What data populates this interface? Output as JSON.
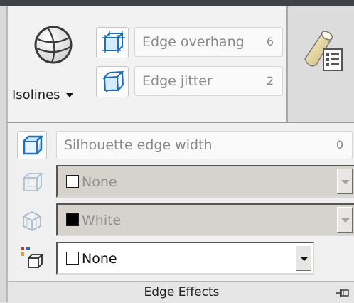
{
  "panel": {
    "title": "Edge Effects",
    "pin_icon": "pin-icon"
  },
  "isolines": {
    "label": "Isolines",
    "icon": "sphere-icon"
  },
  "edge_overhang": {
    "label": "Edge overhang",
    "value": "6",
    "icon": "overhang-cube-icon"
  },
  "edge_jitter": {
    "label": "Edge jitter",
    "value": "2",
    "icon": "jitter-cube-icon"
  },
  "silhouette": {
    "label": "Silhouette edge width",
    "value": "0",
    "icon": "silhouette-cube-icon"
  },
  "selects": [
    {
      "value": "None",
      "swatch_color": "#ffffff",
      "enabled": false,
      "icon": "obscured-edges-icon"
    },
    {
      "value": "White",
      "swatch_color": "#000000",
      "enabled": false,
      "icon": "face-color-icon"
    },
    {
      "value": "None",
      "swatch_color": "#ffffff",
      "enabled": true,
      "icon": "color-edges-icon"
    }
  ],
  "side_panel": {
    "icon": "cylinder-list-icon"
  }
}
